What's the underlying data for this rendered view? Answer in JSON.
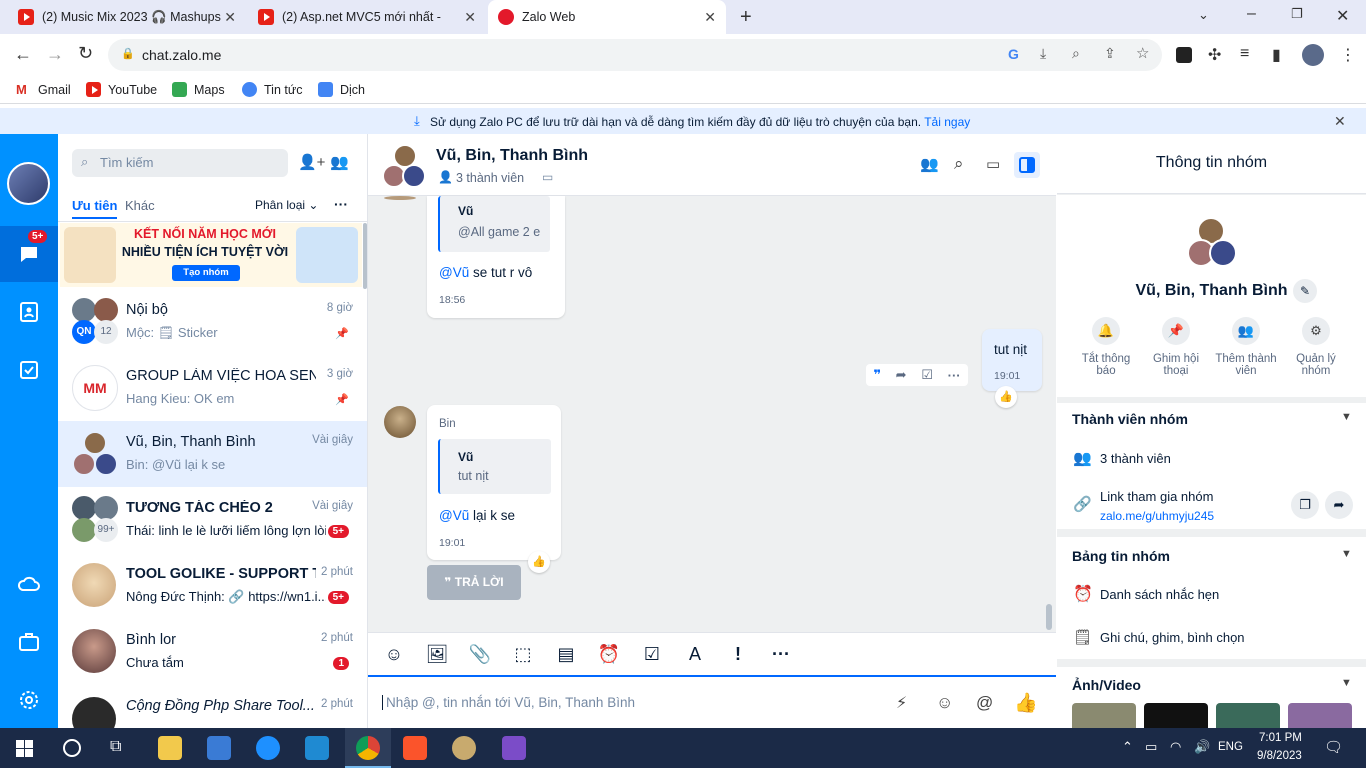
{
  "browser": {
    "tabs": [
      {
        "title": "(2) Music Mix 2023 🎧 Mashups"
      },
      {
        "title": "(2) Asp.net MVC5 mới nhất -"
      },
      {
        "title": "Zalo Web"
      }
    ],
    "url": "chat.zalo.me",
    "bookmarks": [
      {
        "label": "Gmail"
      },
      {
        "label": "YouTube"
      },
      {
        "label": "Maps"
      },
      {
        "label": "Tin tức"
      },
      {
        "label": "Dịch"
      }
    ]
  },
  "banner": {
    "text": "Sử dụng Zalo PC để lưu trữ dài hạn và dễ dàng tìm kiếm đầy đủ dữ liệu trò chuyện của bạn.",
    "link": "Tải ngay"
  },
  "nav": {
    "badge": "5+"
  },
  "conversations": {
    "search_placeholder": "Tìm kiếm",
    "tab_priority": "Ưu tiên",
    "tab_other": "Khác",
    "classify": "Phân loại",
    "promo": {
      "line1": "KẾT NỐI NĂM HỌC MỚI",
      "line2": "NHIỀU TIỆN ÍCH TUYỆT VỜI",
      "button": "Tạo nhóm"
    },
    "items": [
      {
        "name": "Nội bộ",
        "preview": "Mộc: 🗒 Sticker",
        "time": "8 giờ",
        "extra": "12",
        "pinned": true
      },
      {
        "name": "GROUP LÀM VIỆC HOA SEN...",
        "preview": "Hang Kieu: OK em",
        "time": "3 giờ",
        "pinned": true
      },
      {
        "name": "Vũ, Bin, Thanh Bình",
        "preview": "Bin: @Vũ lại k se",
        "time": "Vài giây"
      },
      {
        "name": "TƯƠNG TÁC CHÉO 2",
        "preview": "Thái: linh le lè lưỡi liếm lông lợn lòi",
        "time": "Vài giây",
        "badge": "5+",
        "extra": "99+"
      },
      {
        "name": "TOOL GOLIKE - SUPPORT T...",
        "preview": "Nông Đức Thịnh: 🔗 https://wn1.i...",
        "time": "2 phút",
        "badge": "5+"
      },
      {
        "name": "Bình lor",
        "preview": "Chưa tắm",
        "time": "2 phút",
        "badge": "1"
      },
      {
        "name": "Cộng Đồng Php Share Tool...",
        "preview": "",
        "time": "2 phút"
      }
    ]
  },
  "chat": {
    "title": "Vũ, Bin, Thanh Bình",
    "members": "3 thành viên",
    "messages": [
      {
        "quote_name": "Vũ",
        "quote_text": "@All game 2 e",
        "mention": "@Vũ",
        "text": " se tut r vô",
        "time": "18:56"
      },
      {
        "mine": true,
        "text": "tut nịt",
        "time": "19:01"
      },
      {
        "sender": "Bin",
        "quote_name": "Vũ",
        "quote_text": "tut nịt",
        "mention": "@Vũ",
        "text": " lại k se",
        "time": "19:01"
      }
    ],
    "reply_button": "TRẢ LỜI",
    "input_placeholder": "Nhập @, tin nhắn tới Vũ, Bin, Thanh Bình"
  },
  "info": {
    "header": "Thông tin nhóm",
    "group_name": "Vũ, Bin, Thanh Bình",
    "actions": [
      {
        "label": "Tắt thông báo",
        "icon": "bell-icon"
      },
      {
        "label": "Ghim hội thoại",
        "icon": "pin-icon"
      },
      {
        "label": "Thêm thành viên",
        "icon": "add-member-icon"
      },
      {
        "label": "Quản lý nhóm",
        "icon": "gear-icon"
      }
    ],
    "members_title": "Thành viên nhóm",
    "members_count": "3 thành viên",
    "invite_label": "Link tham gia nhóm",
    "invite_link": "zalo.me/g/uhmyju245",
    "board_title": "Bảng tin nhóm",
    "board_items": [
      "Danh sách nhắc hẹn",
      "Ghi chú, ghim, bình chọn"
    ],
    "media_title": "Ảnh/Video"
  },
  "taskbar": {
    "lang": "ENG",
    "time": "7:01 PM",
    "date": "9/8/2023"
  },
  "colors": {
    "zalo_blue": "#0091ff",
    "nav_selected": "#006edc",
    "badge_red": "#e3192b",
    "mention_blue": "#0068ff"
  }
}
